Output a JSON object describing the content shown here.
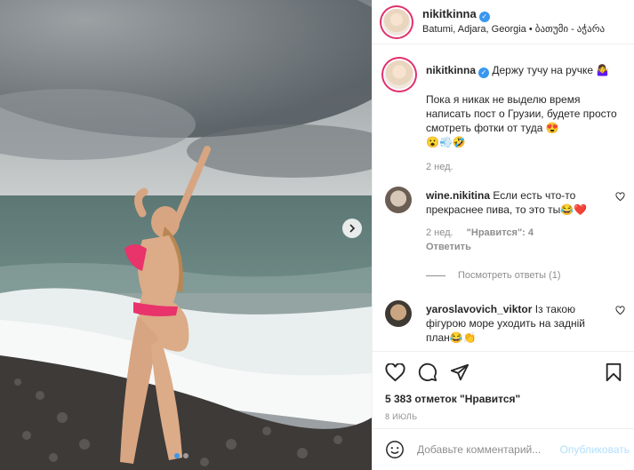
{
  "post": {
    "username": "nikitkinna",
    "location": "Batumi, Adjara, Georgia • ბათუმი - აჭარა",
    "caption_title": "Держу тучу на ручке 🤷‍♀️",
    "caption_body": "Пока я никак не выделю время написать пост о Грузии, будете просто смотреть фотки от туда 😍",
    "caption_tail": "😮💨🤣",
    "caption_age": "2 нед."
  },
  "comments": [
    {
      "username": "wine.nikitina",
      "text": "Если есть что-то прекраснее пива, то это ты😂❤️",
      "age": "2 нед.",
      "likes": "\"Нравится\": 4",
      "reply": "Ответить",
      "view_replies": "Посмотреть ответы (1)"
    },
    {
      "username": "yaroslavovich_viktor",
      "text": "Із такою фігурою море уходить на задній план😂👏"
    }
  ],
  "actions": {
    "likes": "5 383 отметок \"Нравится\"",
    "date": "8 июль"
  },
  "add_comment": {
    "placeholder": "Добавьте комментарий...",
    "publish": "Опубликовать"
  },
  "carousel": {
    "count": 2,
    "active": 1
  },
  "colors": {
    "accent": "#3897f0",
    "text": "#262626",
    "muted": "#8e8e8e",
    "bikini": "#e8336b"
  }
}
